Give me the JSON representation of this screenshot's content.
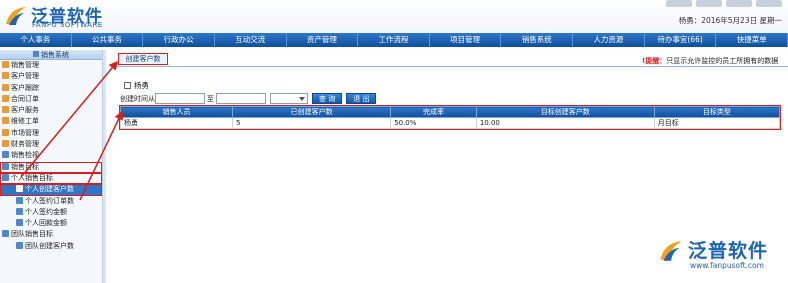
{
  "header": {
    "logo_cn": "泛普软件",
    "logo_en": "FANPU SOFTWARE",
    "user_info": "杨勇：2016年5月23日 星期一"
  },
  "nav": [
    "个人事务",
    "公共事务",
    "行政办公",
    "互动交流",
    "资产管理",
    "工作流程",
    "项目管理",
    "销售系统",
    "人力资源",
    "待办事宜(66)",
    "快捷菜单"
  ],
  "sidebar": {
    "title": "销售系统",
    "items": [
      {
        "label": "销售管理",
        "level": 0,
        "icon": "folder-icon"
      },
      {
        "label": "客户管理",
        "level": 0,
        "icon": "folder-icon"
      },
      {
        "label": "客户跟踪",
        "level": 0,
        "icon": "folder-icon"
      },
      {
        "label": "合同订单",
        "level": 0,
        "icon": "folder-icon"
      },
      {
        "label": "客户服务",
        "level": 0,
        "icon": "folder-icon"
      },
      {
        "label": "维修工单",
        "level": 0,
        "icon": "folder-icon"
      },
      {
        "label": "市场管理",
        "level": 0,
        "icon": "folder-icon"
      },
      {
        "label": "财务管理",
        "level": 0,
        "icon": "folder-icon"
      },
      {
        "label": "销售检视",
        "level": 0,
        "icon": "chart-icon"
      },
      {
        "label": "销售目标",
        "level": 0,
        "icon": "chart-icon"
      },
      {
        "label": "个人销售目标",
        "level": 0,
        "icon": "chart-icon"
      },
      {
        "label": "个人创建客户数",
        "level": 1,
        "icon": "chart-icon"
      },
      {
        "label": "个人签约订单数",
        "level": 1,
        "icon": "chart-icon"
      },
      {
        "label": "个人签约金额",
        "level": 1,
        "icon": "chart-icon"
      },
      {
        "label": "个人回款金额",
        "level": 1,
        "icon": "chart-icon"
      },
      {
        "label": "团队销售目标",
        "level": 0,
        "icon": "chart-icon"
      },
      {
        "label": "团队创建客户数",
        "level": 1,
        "icon": "chart-icon"
      }
    ]
  },
  "tab": {
    "label": "创建客户数"
  },
  "notice": {
    "prefix": "!提醒：",
    "text": "只显示允许监控的员工所拥有的数据"
  },
  "filter": {
    "checkbox_label": "杨勇",
    "date_label": "创建时间从",
    "to_label": "至",
    "query_button": "查 询",
    "exit_button": "退 出"
  },
  "table": {
    "headers": [
      "销售人员",
      "已创建客户数",
      "完成率",
      "目标创建客户数",
      "目标类型"
    ],
    "rows": [
      [
        "杨勇",
        "5",
        "50.0%",
        "10.00",
        "月目标"
      ]
    ]
  },
  "watermark": {
    "cn": "泛普软件",
    "url": "www.fanpusoft.com"
  },
  "colors": {
    "accent": "#1d63b6",
    "nav": "#1559a8",
    "highlight": "#d61f1f"
  }
}
